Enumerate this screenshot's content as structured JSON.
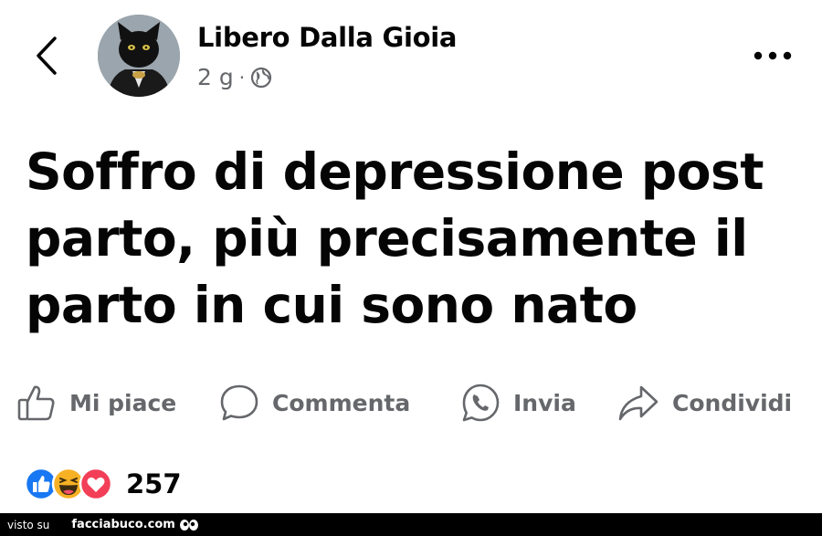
{
  "header": {
    "author": "Libero Dalla Gioia",
    "time": "2 g",
    "separator": "·",
    "visibility_icon": "globe-icon"
  },
  "post": {
    "text": "Soffro di depressione post parto, più precisamente il parto in cui sono nato"
  },
  "actions": {
    "like_label": "Mi piace",
    "comment_label": "Commenta",
    "send_label": "Invia",
    "share_label": "Condividi"
  },
  "reactions": {
    "icons": [
      "like-reaction-icon",
      "haha-reaction-icon",
      "love-reaction-icon"
    ],
    "count": "257"
  },
  "footer": {
    "visto_label": "visto su",
    "site": "facciabuco.com"
  },
  "colors": {
    "text": "#050505",
    "secondary": "#65676b",
    "like_blue": "#1877f2",
    "love_red": "#f33e58",
    "haha_yellow": "#f7b125"
  }
}
